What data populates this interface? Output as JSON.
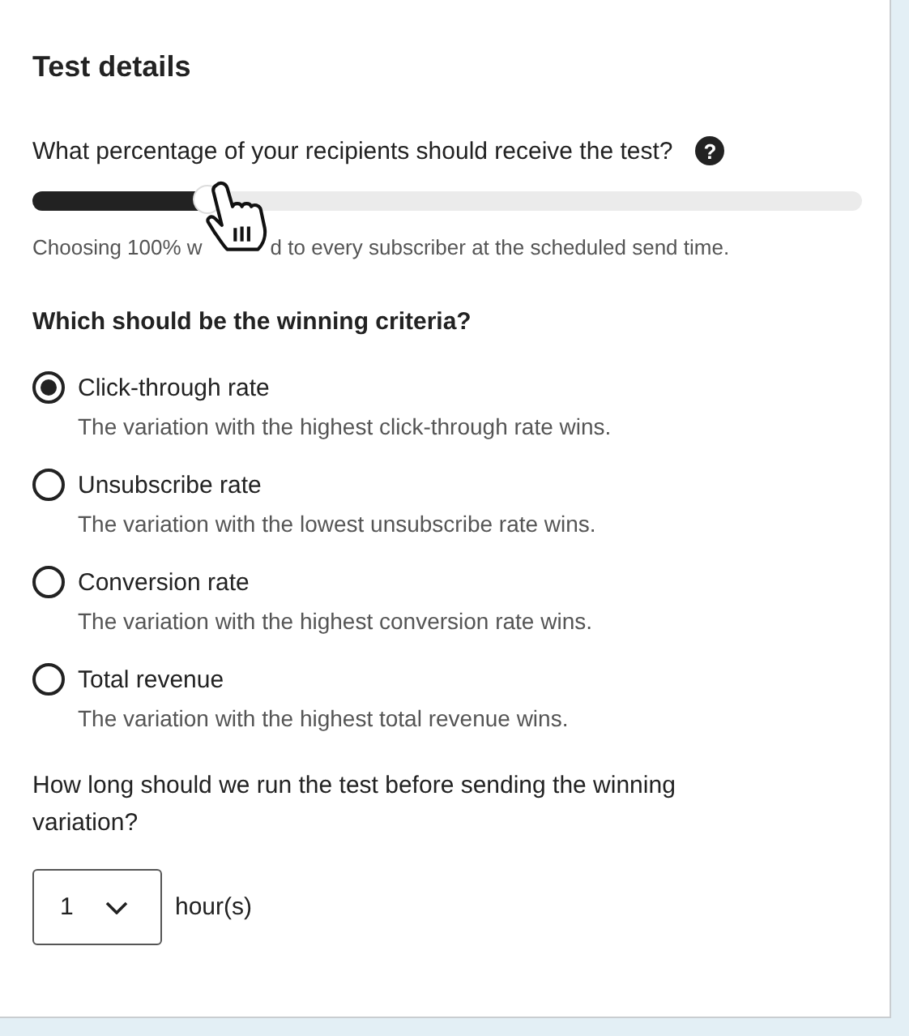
{
  "title": "Test details",
  "percentage": {
    "question": "What percentage of your recipients should receive the test?",
    "help_icon": "?",
    "level": 0.21,
    "hint_before_cursor": "Choosing 100% w",
    "hint_after_cursor": "d to every subscriber at the scheduled send time."
  },
  "criteria": {
    "heading": "Which should be the winning criteria?",
    "options": [
      {
        "label": "Click-through rate",
        "description": "The variation with the highest click-through rate wins.",
        "selected": true
      },
      {
        "label": "Unsubscribe rate",
        "description": "The variation with the lowest unsubscribe rate wins.",
        "selected": false
      },
      {
        "label": "Conversion rate",
        "description": "The variation with the highest conversion rate wins.",
        "selected": false
      },
      {
        "label": "Total revenue",
        "description": "The variation with the highest total revenue wins.",
        "selected": false
      }
    ]
  },
  "duration": {
    "question": "How long should we run the test before sending the winning variation?",
    "value": "1",
    "unit": "hour(s)"
  }
}
